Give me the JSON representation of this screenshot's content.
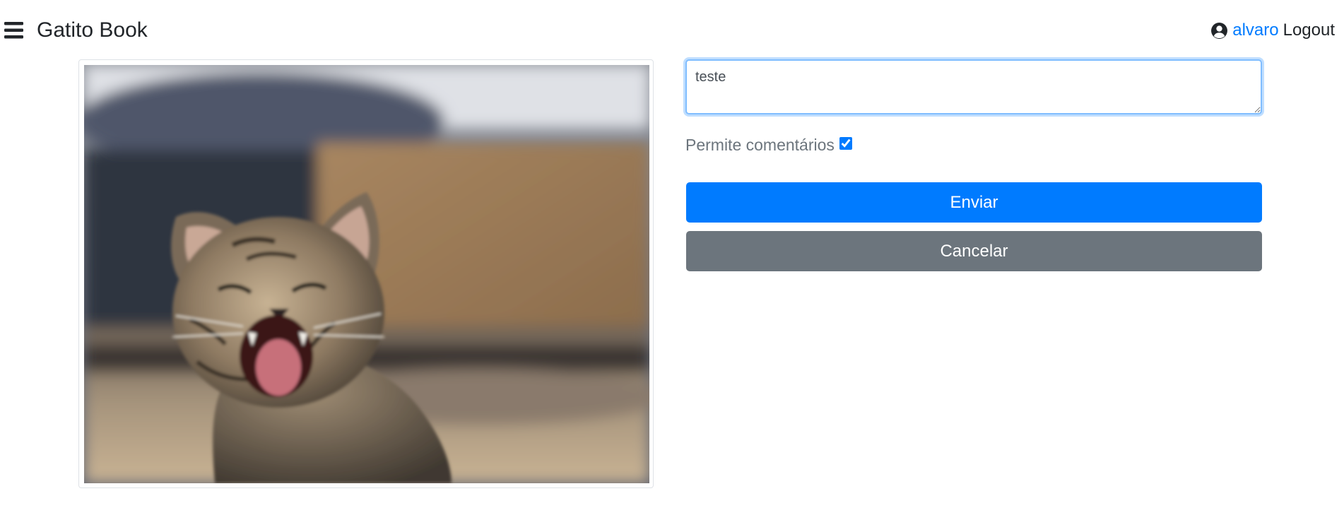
{
  "navbar": {
    "brand": "Gatito Book",
    "menu_icon": "bars-icon",
    "user_icon": "user-circle-icon",
    "username": "alvaro",
    "logout_label": "Logout"
  },
  "photo": {
    "subject": "yawning tabby kitten"
  },
  "form": {
    "description_value": "teste",
    "allow_comments_label": "Permite comentários",
    "allow_comments_checked": true,
    "submit_label": "Enviar",
    "cancel_label": "Cancelar"
  },
  "colors": {
    "primary": "#007bff",
    "secondary": "#6c757d",
    "focus_border": "#80bdff",
    "text": "#212529"
  }
}
